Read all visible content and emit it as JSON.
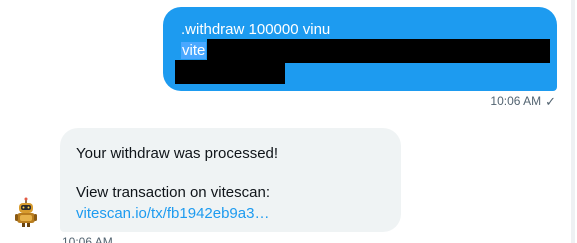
{
  "outgoing": {
    "line1": ".withdraw 100000 vinu",
    "line2": "vite",
    "time": "10:06 AM",
    "status_icon": "checkmark-icon"
  },
  "incoming": {
    "line1": "Your withdraw was processed!",
    "line2": "View transaction on vitescan:",
    "link": "vitescan.io/tx/fb1942eb9a3…",
    "time": "10:06 AM",
    "avatar_icon": "robot-avatar-icon"
  },
  "colors": {
    "outgoing_bubble": "#1d9bf0",
    "incoming_bubble": "#eff3f4",
    "link": "#1d9bf0",
    "meta_text": "#536471",
    "redaction": "#000000"
  }
}
